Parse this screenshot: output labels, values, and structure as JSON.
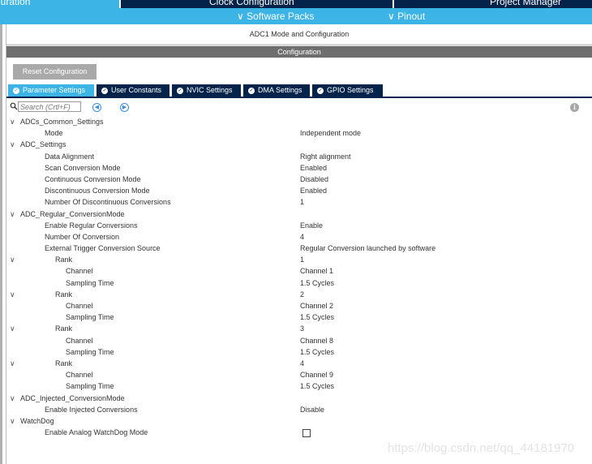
{
  "top_tabs": [
    "guration",
    "Clock Configuration",
    "Project Manager"
  ],
  "sub_menu": [
    "Software Packs",
    "Pinout"
  ],
  "mode_title": "ADC1 Mode and Configuration",
  "config_bar": "Configuration",
  "reset_button": "Reset Configuration",
  "tabs": [
    "Parameter Settings",
    "User Constants",
    "NVIC Settings",
    "DMA Settings",
    "GPIO Settings"
  ],
  "search": {
    "placeholder": "Search (Crtl+F)"
  },
  "groups": {
    "adcs_common": "ADCs_Common_Settings",
    "adc_settings": "ADC_Settings",
    "regular": "ADC_Regular_ConversionMode",
    "injected": "ADC_Injected_ConversionMode",
    "watchdog": "WatchDog"
  },
  "params": [
    {
      "label": "Mode",
      "value": "Independent mode"
    },
    {
      "label": "Data Alignment",
      "value": "Right alignment"
    },
    {
      "label": "Scan Conversion Mode",
      "value": "Enabled"
    },
    {
      "label": "Continuous Conversion Mode",
      "value": "Disabled"
    },
    {
      "label": "Discontinuous Conversion Mode",
      "value": "Enabled"
    },
    {
      "label": "Number Of Discontinuous Conversions",
      "value": "1"
    },
    {
      "label": "Enable Regular Conversions",
      "value": "Enable"
    },
    {
      "label": "Number Of Conversion",
      "value": "4"
    },
    {
      "label": "External Trigger Conversion Source",
      "value": "Regular Conversion launched by software"
    },
    {
      "label": "Enable Injected Conversions",
      "value": "Disable"
    },
    {
      "label": "Enable Analog WatchDog Mode",
      "value": ""
    }
  ],
  "ranks": [
    {
      "label": "Rank",
      "value": "1",
      "channel_label": "Channel",
      "channel": "Channel 1",
      "sampling_label": "Sampling Time",
      "sampling": "1.5 Cycles"
    },
    {
      "label": "Rank",
      "value": "2",
      "channel_label": "Channel",
      "channel": "Channel 2",
      "sampling_label": "Sampling Time",
      "sampling": "1.5 Cycles"
    },
    {
      "label": "Rank",
      "value": "3",
      "channel_label": "Channel",
      "channel": "Channel 8",
      "sampling_label": "Sampling Time",
      "sampling": "1.5 Cycles"
    },
    {
      "label": "Rank",
      "value": "4",
      "channel_label": "Channel",
      "channel": "Channel 9",
      "sampling_label": "Sampling Time",
      "sampling": "1.5 Cycles"
    }
  ],
  "watermark": "https://blog.csdn.net/qq_44181970",
  "colors": {
    "accent": "#3cb4e6",
    "dark_navy": "#03234b",
    "config_bar": "#6e6e6e",
    "reset_button": "#a9a9a9"
  }
}
